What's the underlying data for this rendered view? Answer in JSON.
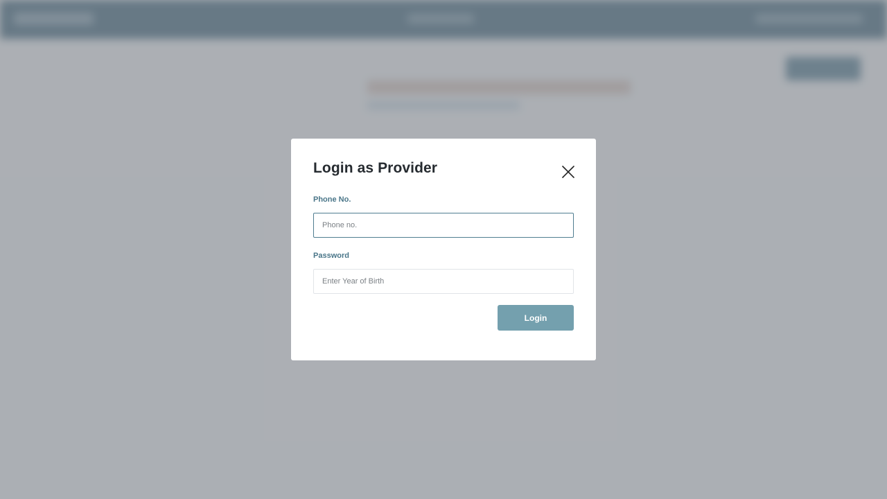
{
  "modal": {
    "title": "Login as Provider",
    "phone_label": "Phone No.",
    "phone_placeholder": "Phone no.",
    "phone_value": "",
    "password_label": "Password",
    "password_placeholder": "Enter Year of Birth",
    "password_value": "",
    "login_label": "Login",
    "close_icon": "close-icon"
  },
  "colors": {
    "header": "#4f7286",
    "accent_label": "#4a7689",
    "login_button": "#74a0ae",
    "active_input_border": "#4f7d90",
    "overlay": "rgba(120,125,133,0.58)"
  }
}
